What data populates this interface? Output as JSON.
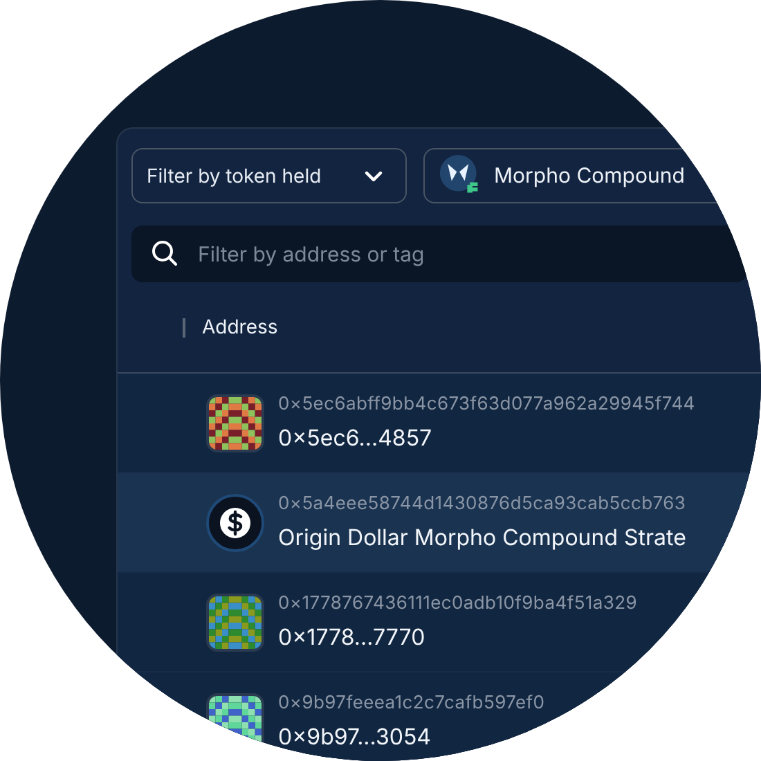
{
  "filters": {
    "token_dropdown": {
      "label": "Filter by token held"
    },
    "token_chip": {
      "label": "Morpho Compound"
    }
  },
  "search": {
    "placeholder": "Filter by address or tag"
  },
  "table": {
    "columns": [
      "Address"
    ],
    "rows": [
      {
        "kind": "identicon",
        "selected": false,
        "address": "0×5ec6abff9bb4c673f63d077a962a29945f744",
        "label": "0×5ec6...4857"
      },
      {
        "kind": "token",
        "selected": true,
        "address": "0×5a4eee58744d1430876d5ca93cab5ccb763",
        "label": "Origin Dollar Morpho Compound Strate"
      },
      {
        "kind": "identicon",
        "selected": false,
        "address": "0×1778767436111ec0adb10f9ba4f51a329",
        "label": "0×1778...7770"
      },
      {
        "kind": "identicon",
        "selected": false,
        "address": "0×9b97feeea1c2c7cafb597ef0",
        "label": "0×9b97...3054"
      }
    ]
  }
}
